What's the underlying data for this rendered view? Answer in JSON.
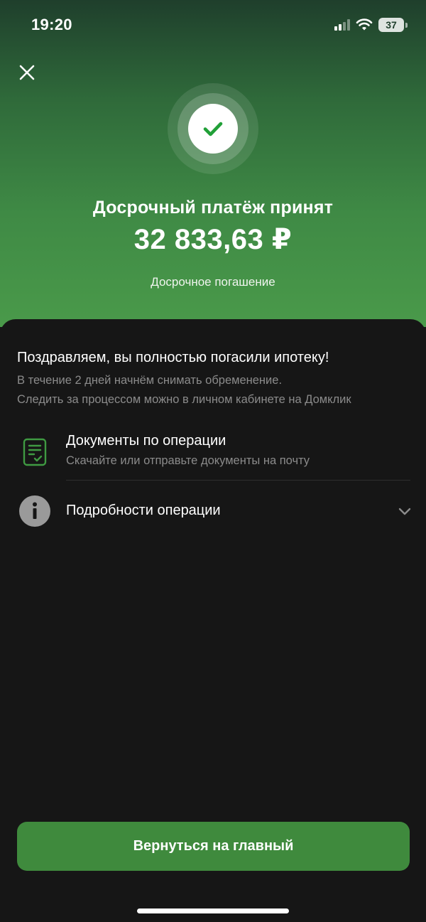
{
  "status_bar": {
    "time": "19:20",
    "battery": "37",
    "icons": [
      "signal-icon",
      "wifi-icon",
      "battery-icon"
    ]
  },
  "hero": {
    "close_icon": "close-icon",
    "success_icon": "check-circle-icon",
    "title": "Досрочный платёж принят",
    "amount": "32 833,63 ₽",
    "subtitle": "Досрочное погашение"
  },
  "sheet": {
    "congrats": "Поздравляем, вы полностью погасили ипотеку!",
    "note_line1": "В течение 2 дней начнём снимать обременение.",
    "note_line2": "Следить за процессом можно в личном кабинете на Домклик",
    "items": [
      {
        "icon": "document-icon",
        "title": "Документы по операции",
        "subtitle": "Скачайте или отправьте документы на почту"
      },
      {
        "icon": "info-icon",
        "title": "Подробности операции",
        "trailing_icon": "chevron-down-icon"
      }
    ],
    "button_label": "Вернуться на главный"
  },
  "colors": {
    "accent_green": "#3f8a3d",
    "sheet_background": "#161616",
    "secondary_text": "#8b8b8b"
  }
}
